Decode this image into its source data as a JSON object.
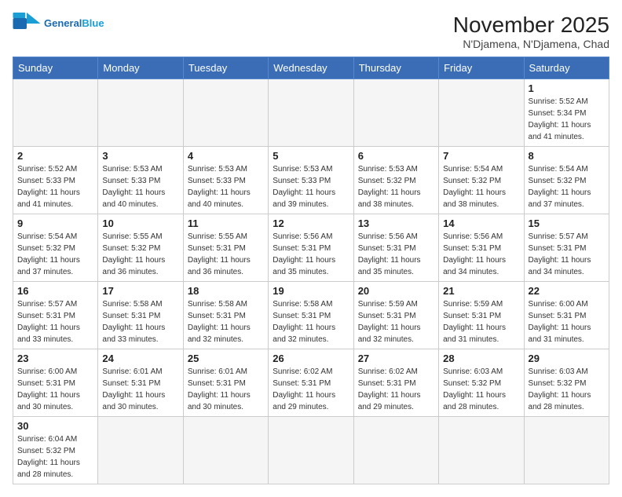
{
  "header": {
    "logo_general": "General",
    "logo_blue": "Blue",
    "month": "November 2025",
    "location": "N'Djamena, N'Djamena, Chad"
  },
  "weekdays": [
    "Sunday",
    "Monday",
    "Tuesday",
    "Wednesday",
    "Thursday",
    "Friday",
    "Saturday"
  ],
  "weeks": [
    [
      {
        "day": "",
        "info": ""
      },
      {
        "day": "",
        "info": ""
      },
      {
        "day": "",
        "info": ""
      },
      {
        "day": "",
        "info": ""
      },
      {
        "day": "",
        "info": ""
      },
      {
        "day": "",
        "info": ""
      },
      {
        "day": "1",
        "info": "Sunrise: 5:52 AM\nSunset: 5:34 PM\nDaylight: 11 hours\nand 41 minutes."
      }
    ],
    [
      {
        "day": "2",
        "info": "Sunrise: 5:52 AM\nSunset: 5:33 PM\nDaylight: 11 hours\nand 41 minutes."
      },
      {
        "day": "3",
        "info": "Sunrise: 5:53 AM\nSunset: 5:33 PM\nDaylight: 11 hours\nand 40 minutes."
      },
      {
        "day": "4",
        "info": "Sunrise: 5:53 AM\nSunset: 5:33 PM\nDaylight: 11 hours\nand 40 minutes."
      },
      {
        "day": "5",
        "info": "Sunrise: 5:53 AM\nSunset: 5:33 PM\nDaylight: 11 hours\nand 39 minutes."
      },
      {
        "day": "6",
        "info": "Sunrise: 5:53 AM\nSunset: 5:32 PM\nDaylight: 11 hours\nand 38 minutes."
      },
      {
        "day": "7",
        "info": "Sunrise: 5:54 AM\nSunset: 5:32 PM\nDaylight: 11 hours\nand 38 minutes."
      },
      {
        "day": "8",
        "info": "Sunrise: 5:54 AM\nSunset: 5:32 PM\nDaylight: 11 hours\nand 37 minutes."
      }
    ],
    [
      {
        "day": "9",
        "info": "Sunrise: 5:54 AM\nSunset: 5:32 PM\nDaylight: 11 hours\nand 37 minutes."
      },
      {
        "day": "10",
        "info": "Sunrise: 5:55 AM\nSunset: 5:32 PM\nDaylight: 11 hours\nand 36 minutes."
      },
      {
        "day": "11",
        "info": "Sunrise: 5:55 AM\nSunset: 5:31 PM\nDaylight: 11 hours\nand 36 minutes."
      },
      {
        "day": "12",
        "info": "Sunrise: 5:56 AM\nSunset: 5:31 PM\nDaylight: 11 hours\nand 35 minutes."
      },
      {
        "day": "13",
        "info": "Sunrise: 5:56 AM\nSunset: 5:31 PM\nDaylight: 11 hours\nand 35 minutes."
      },
      {
        "day": "14",
        "info": "Sunrise: 5:56 AM\nSunset: 5:31 PM\nDaylight: 11 hours\nand 34 minutes."
      },
      {
        "day": "15",
        "info": "Sunrise: 5:57 AM\nSunset: 5:31 PM\nDaylight: 11 hours\nand 34 minutes."
      }
    ],
    [
      {
        "day": "16",
        "info": "Sunrise: 5:57 AM\nSunset: 5:31 PM\nDaylight: 11 hours\nand 33 minutes."
      },
      {
        "day": "17",
        "info": "Sunrise: 5:58 AM\nSunset: 5:31 PM\nDaylight: 11 hours\nand 33 minutes."
      },
      {
        "day": "18",
        "info": "Sunrise: 5:58 AM\nSunset: 5:31 PM\nDaylight: 11 hours\nand 32 minutes."
      },
      {
        "day": "19",
        "info": "Sunrise: 5:58 AM\nSunset: 5:31 PM\nDaylight: 11 hours\nand 32 minutes."
      },
      {
        "day": "20",
        "info": "Sunrise: 5:59 AM\nSunset: 5:31 PM\nDaylight: 11 hours\nand 32 minutes."
      },
      {
        "day": "21",
        "info": "Sunrise: 5:59 AM\nSunset: 5:31 PM\nDaylight: 11 hours\nand 31 minutes."
      },
      {
        "day": "22",
        "info": "Sunrise: 6:00 AM\nSunset: 5:31 PM\nDaylight: 11 hours\nand 31 minutes."
      }
    ],
    [
      {
        "day": "23",
        "info": "Sunrise: 6:00 AM\nSunset: 5:31 PM\nDaylight: 11 hours\nand 30 minutes."
      },
      {
        "day": "24",
        "info": "Sunrise: 6:01 AM\nSunset: 5:31 PM\nDaylight: 11 hours\nand 30 minutes."
      },
      {
        "day": "25",
        "info": "Sunrise: 6:01 AM\nSunset: 5:31 PM\nDaylight: 11 hours\nand 30 minutes."
      },
      {
        "day": "26",
        "info": "Sunrise: 6:02 AM\nSunset: 5:31 PM\nDaylight: 11 hours\nand 29 minutes."
      },
      {
        "day": "27",
        "info": "Sunrise: 6:02 AM\nSunset: 5:31 PM\nDaylight: 11 hours\nand 29 minutes."
      },
      {
        "day": "28",
        "info": "Sunrise: 6:03 AM\nSunset: 5:32 PM\nDaylight: 11 hours\nand 28 minutes."
      },
      {
        "day": "29",
        "info": "Sunrise: 6:03 AM\nSunset: 5:32 PM\nDaylight: 11 hours\nand 28 minutes."
      }
    ],
    [
      {
        "day": "30",
        "info": "Sunrise: 6:04 AM\nSunset: 5:32 PM\nDaylight: 11 hours\nand 28 minutes."
      },
      {
        "day": "",
        "info": ""
      },
      {
        "day": "",
        "info": ""
      },
      {
        "day": "",
        "info": ""
      },
      {
        "day": "",
        "info": ""
      },
      {
        "day": "",
        "info": ""
      },
      {
        "day": "",
        "info": ""
      }
    ]
  ]
}
